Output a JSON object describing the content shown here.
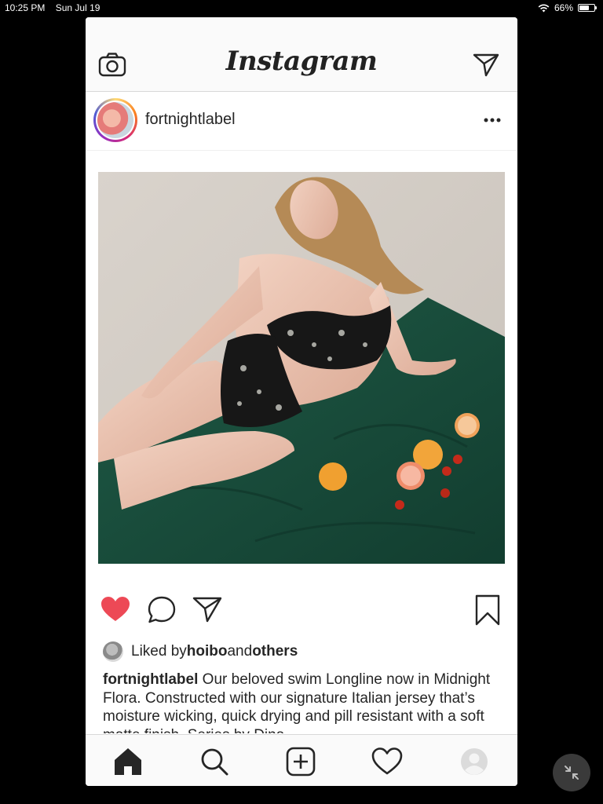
{
  "status_bar": {
    "time": "10:25 PM",
    "date": "Sun Jul 19",
    "battery": "66%",
    "battery_level": 0.66,
    "icons": [
      "wifi-icon",
      "battery-icon"
    ]
  },
  "app": {
    "logo": "Instagram",
    "header_icons": [
      "camera-icon",
      "direct-message-icon"
    ]
  },
  "post": {
    "username": "fortnightlabel",
    "liked_by_prefix": "Liked by ",
    "liked_by_user": "hoibo",
    "liked_by_and": " and ",
    "liked_by_others": "others",
    "liked": true,
    "caption_user": "fortnightlabel",
    "caption_text": " Our beloved swim Longline now in Midnight Flora. Constructed with our signature Italian jersey that’s moisture wicking, quick drying and pill resistant with a soft matte finish. Series by Dina",
    "action_icons": [
      "heart-icon",
      "comment-icon",
      "share-icon",
      "bookmark-icon"
    ]
  },
  "tab_bar": {
    "icons": [
      "home-icon",
      "search-icon",
      "new-post-icon",
      "activity-icon",
      "profile-icon"
    ]
  },
  "colors": {
    "like_red": "#ed4956",
    "text": "#262626",
    "bar_bg": "#fafafa"
  }
}
